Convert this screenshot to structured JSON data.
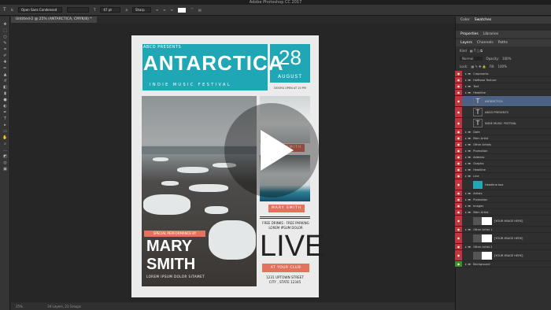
{
  "app": {
    "title": "Adobe Photoshop CC 2017",
    "doc_tab": "Untitled-2 @ 25% (ANTARCTICA, CMYK/8) *"
  },
  "options": {
    "font_family": "Open Sans Condensed",
    "font_size": "67 pt",
    "aa": "Sharp"
  },
  "status": {
    "zoom": "25%",
    "layers": "34 Layers, 21 Groups"
  },
  "poster": {
    "presents": "ABCD PRESENTS",
    "title": "ANTARCTICA",
    "subtitle": "INDIE MUSIC FESTIVAL",
    "day": "28",
    "month": "AUGUST",
    "doors": "DOORS OPEN AT 10 PM",
    "artist_small1": "MARY SMITH",
    "artist_small2": "MARY SMITH",
    "info1": "FREE DRINKS · FREE PARKING",
    "info2": "LOREM IPSUM DOLOR",
    "live": "LIVE",
    "club": "AT YOUR CLUB",
    "addr1": "1231 UPTOWN STREET",
    "addr2": "CITY , STATE 12345",
    "special": "SPECIAL PERFORMANCE BY",
    "mary1": "MARY",
    "mary2": "SMITH",
    "lorem": "LOREM IPSUM DOLOR SITAMET"
  },
  "panel": {
    "tab_color": "Color",
    "tab_swatches": "Swatches",
    "tab_props": "Properties",
    "tab_libs": "Libraries",
    "tab_layers": "Layers",
    "tab_channels": "Channels",
    "tab_paths": "Paths",
    "kind": "Kind",
    "blend": "Normal",
    "opacity": "Opacity:",
    "opacity_val": "100%",
    "lock": "Lock:",
    "fill": "Fill:",
    "fill_val": "100%"
  },
  "layers": [
    {
      "label": "Cropmarks",
      "type": "group"
    },
    {
      "label": "Halftone Texture",
      "type": "group"
    },
    {
      "label": "Text",
      "type": "group"
    },
    {
      "label": "Headline",
      "type": "group"
    },
    {
      "label": "ANTARCTICA",
      "type": "text",
      "selected": true
    },
    {
      "label": "ABCD PRESENTS",
      "type": "text"
    },
    {
      "label": "INDIE MUSIC FESTIVAL",
      "type": "text"
    },
    {
      "label": "Date",
      "type": "group"
    },
    {
      "label": "Main Artist",
      "type": "group"
    },
    {
      "label": "Other Artists",
      "type": "group"
    },
    {
      "label": "Promotion",
      "type": "group"
    },
    {
      "label": "Address",
      "type": "group"
    },
    {
      "label": "Graphic",
      "type": "group"
    },
    {
      "label": "Headline",
      "type": "group"
    },
    {
      "label": "Line",
      "type": "group"
    },
    {
      "label": "Headline box",
      "type": "shape"
    },
    {
      "label": "Artists",
      "type": "group"
    },
    {
      "label": "Promotion",
      "type": "group"
    },
    {
      "label": "Images",
      "type": "group"
    },
    {
      "label": "Main Artist",
      "type": "group"
    },
    {
      "label": "[YOUR IMAGE HERE]",
      "type": "image"
    },
    {
      "label": "Other Artist 1",
      "type": "group"
    },
    {
      "label": "[YOUR IMAGE HERE]",
      "type": "image"
    },
    {
      "label": "Other Artist 2",
      "type": "group"
    },
    {
      "label": "[YOUR IMAGE HERE]",
      "type": "image"
    },
    {
      "label": "Background",
      "type": "group",
      "green": true
    }
  ]
}
